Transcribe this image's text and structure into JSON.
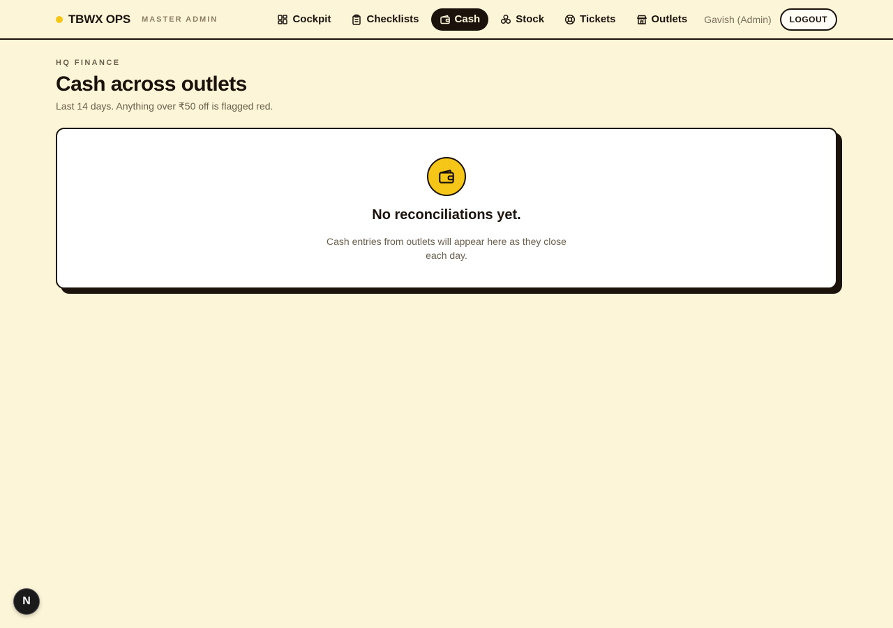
{
  "header": {
    "brand_name": "TBWX OPS",
    "brand_role": "MASTER ADMIN",
    "nav": [
      {
        "label": "Cockpit",
        "icon": "grid-icon"
      },
      {
        "label": "Checklists",
        "icon": "clipboard-icon"
      },
      {
        "label": "Cash",
        "icon": "wallet-icon",
        "active": true
      },
      {
        "label": "Stock",
        "icon": "boxes-icon"
      },
      {
        "label": "Tickets",
        "icon": "lifebuoy-icon"
      },
      {
        "label": "Outlets",
        "icon": "store-icon"
      }
    ],
    "user": "Gavish (Admin)",
    "logout_label": "LOGOUT"
  },
  "main": {
    "eyebrow": "HQ FINANCE",
    "title": "Cash across outlets",
    "subtitle": "Last 14 days. Anything over ₹50 off is flagged red.",
    "empty": {
      "icon": "wallet-icon",
      "title": "No reconciliations yet.",
      "text": "Cash entries from outlets will appear here as they close each day."
    }
  },
  "dev_badge": "N",
  "colors": {
    "background": "#fdf5d8",
    "ink": "#1a120b",
    "accent": "#f5c518",
    "muted": "#6a5e4c"
  }
}
